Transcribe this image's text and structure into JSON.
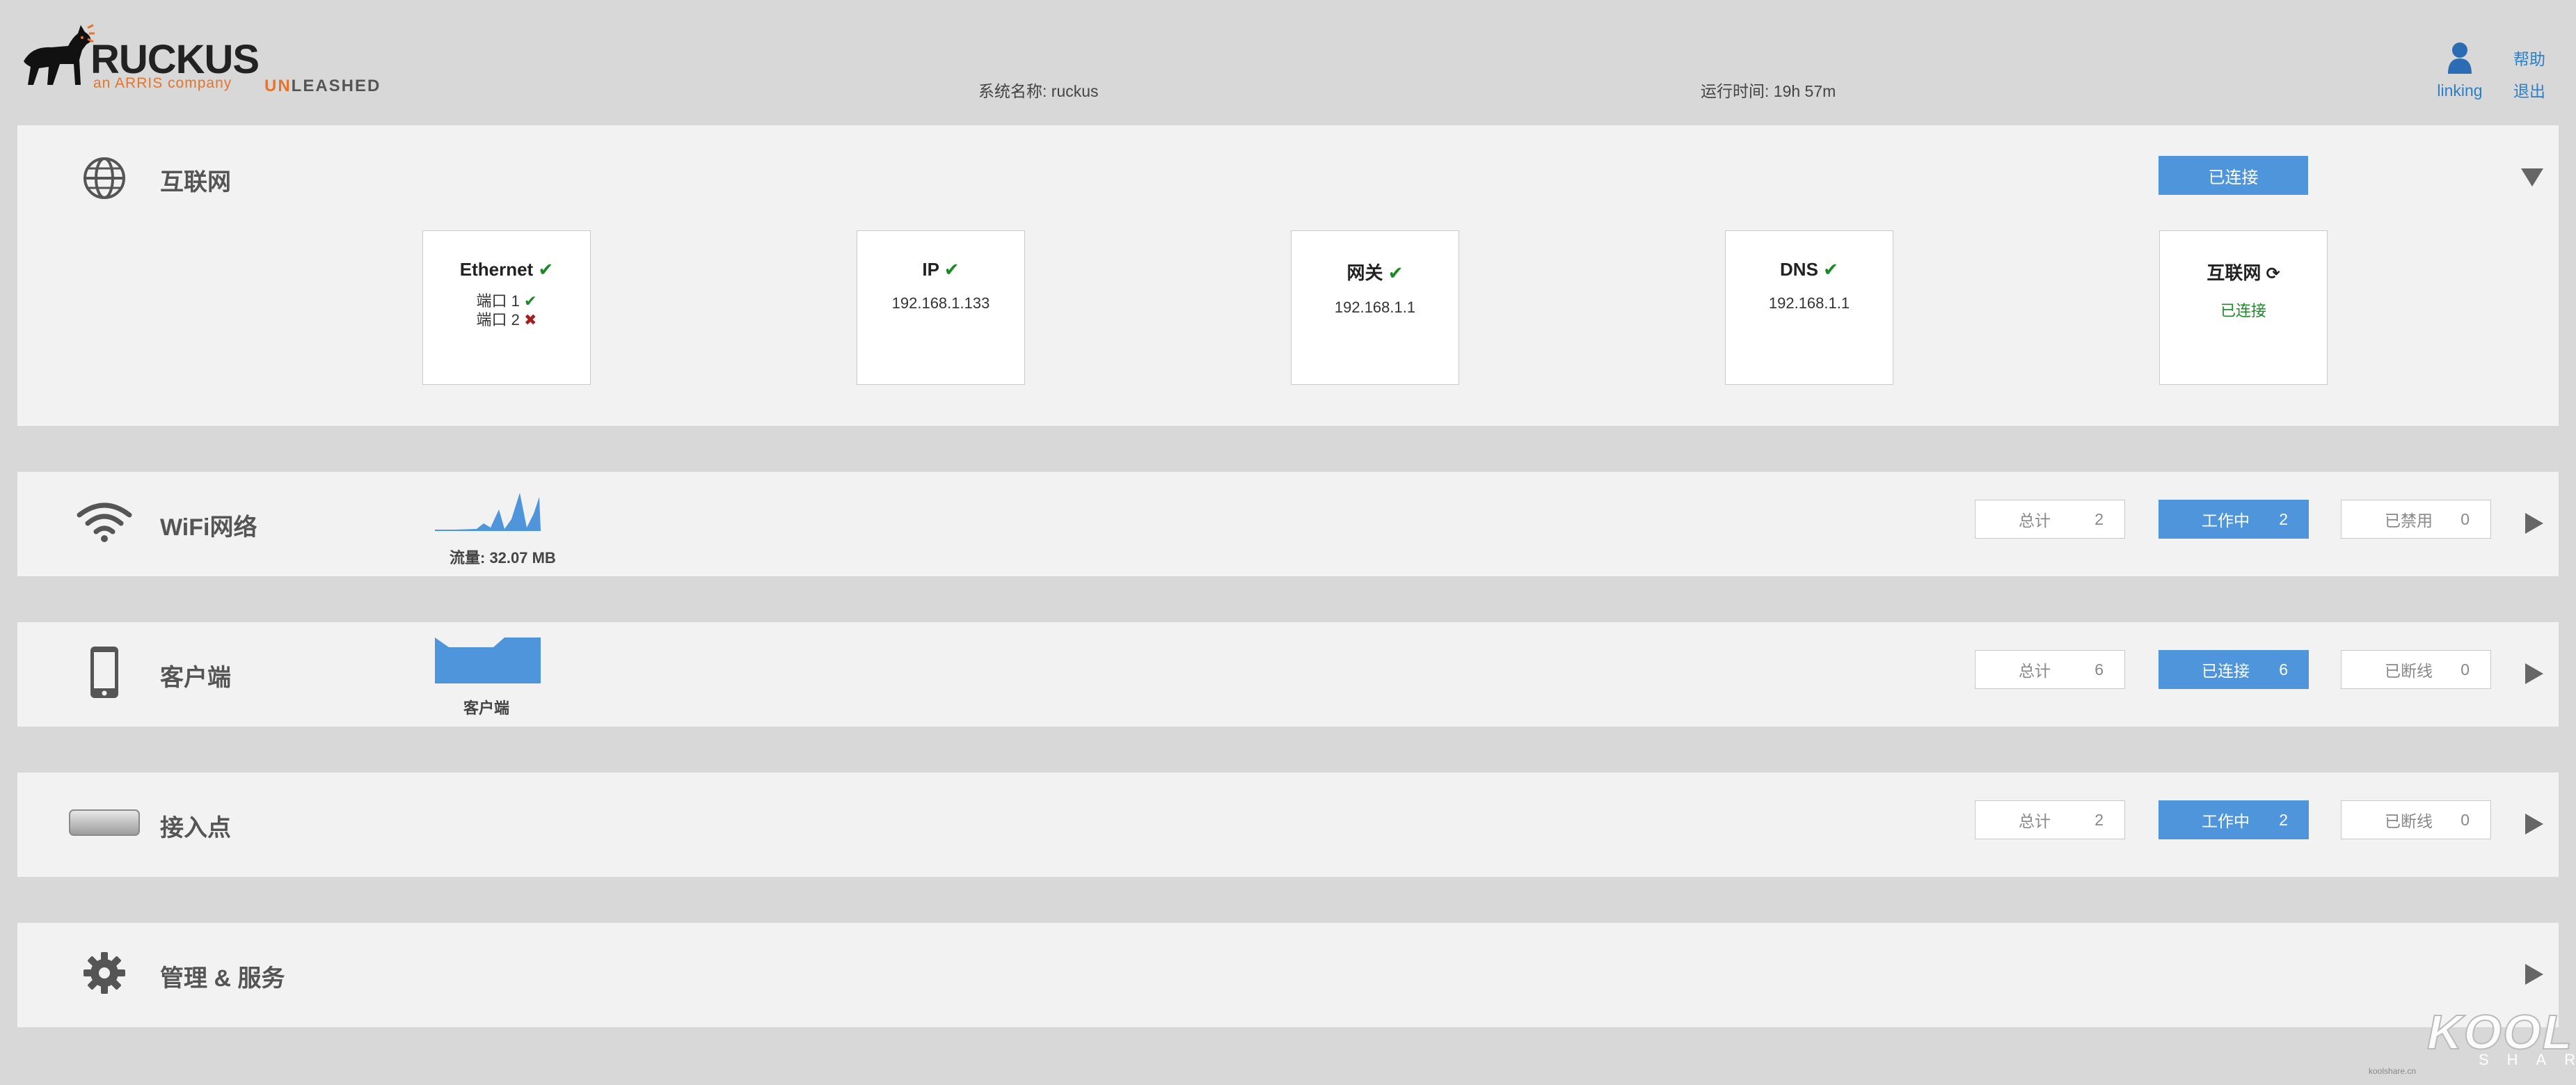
{
  "header": {
    "brand": "RUCKUS",
    "brand_sub": "an ARRIS company",
    "product_prefix": "UN",
    "product_suffix": "LEASHED",
    "system_name": "系统名称: ruckus",
    "uptime": "运行时间: 19h 57m",
    "user": "linking",
    "help": "帮助",
    "logout": "退出"
  },
  "internet": {
    "title": "互联网",
    "status_button": "已连接",
    "cards": [
      {
        "title": "Ethernet",
        "ports": [
          "端口 1",
          "端口 2"
        ]
      },
      {
        "title": "IP",
        "value": "192.168.1.133"
      },
      {
        "title": "网关",
        "value": "192.168.1.1"
      },
      {
        "title": "DNS",
        "value": "192.168.1.1"
      },
      {
        "title": "互联网",
        "value": "已连接"
      }
    ]
  },
  "wifi": {
    "title": "WiFi网络",
    "traffic": "流量: 32.07 MB",
    "stats": [
      {
        "label": "总计",
        "value": "2"
      },
      {
        "label": "工作中",
        "value": "2"
      },
      {
        "label": "已禁用",
        "value": "0"
      }
    ]
  },
  "clients": {
    "title": "客户端",
    "chart_label": "客户端",
    "stats": [
      {
        "label": "总计",
        "value": "6"
      },
      {
        "label": "已连接",
        "value": "6"
      },
      {
        "label": "已断线",
        "value": "0"
      }
    ]
  },
  "aps": {
    "title": "接入点",
    "stats": [
      {
        "label": "总计",
        "value": "2"
      },
      {
        "label": "工作中",
        "value": "2"
      },
      {
        "label": "已断线",
        "value": "0"
      }
    ]
  },
  "admin": {
    "title": "管理 & 服务"
  },
  "watermark": {
    "main": "KOOL",
    "sub": "SHARE",
    "tiny": "koolshare.cn"
  },
  "colors": {
    "accent": "#4f95dc",
    "brand_orange": "#e8732a",
    "ok_green": "#1a8a24",
    "error_red": "#a51f1f"
  }
}
